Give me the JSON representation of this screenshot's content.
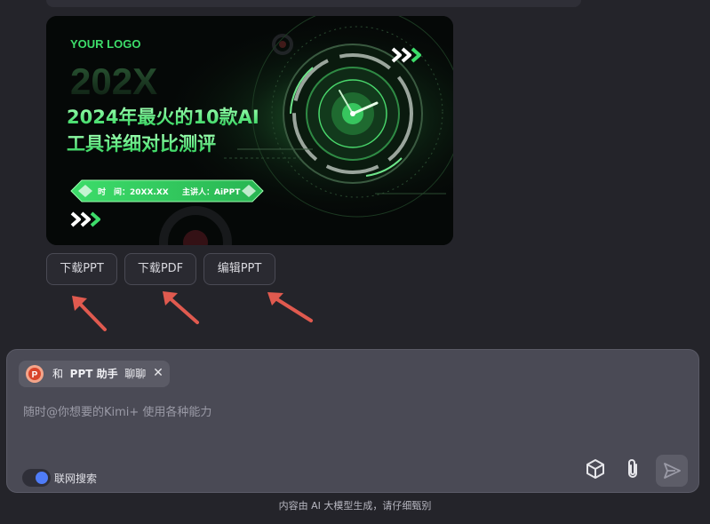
{
  "slide": {
    "logo": "YOUR LOGO",
    "year": "202X",
    "title_line1": "2024年最火的10款AI",
    "title_line2": "工具详细对比测评",
    "time_label": "时　间：20XX.XX",
    "speaker_label": "主讲人：AiPPT"
  },
  "actions": {
    "download_ppt": "下载PPT",
    "download_pdf": "下载PDF",
    "edit_ppt": "编辑PPT"
  },
  "composer": {
    "chip_prefix": "和",
    "chip_name": "PPT 助手",
    "chip_suffix": "聊聊",
    "chip_close": "✕",
    "placeholder": "随时@你想要的Kimi+ 使用各种能力",
    "web_search_label": "联网搜索",
    "web_search_on": true
  },
  "footer": {
    "disclaimer": "内容由 AI 大模型生成，请仔细甄别"
  },
  "icons": {
    "cube": "cube-icon",
    "attach": "paperclip-icon",
    "send": "send-icon",
    "ppt": "ppt-assistant-icon"
  },
  "colors": {
    "accent_green": "#3ddc6a",
    "toggle_blue": "#4f7cf7",
    "arrow_red": "#e05a4f"
  }
}
